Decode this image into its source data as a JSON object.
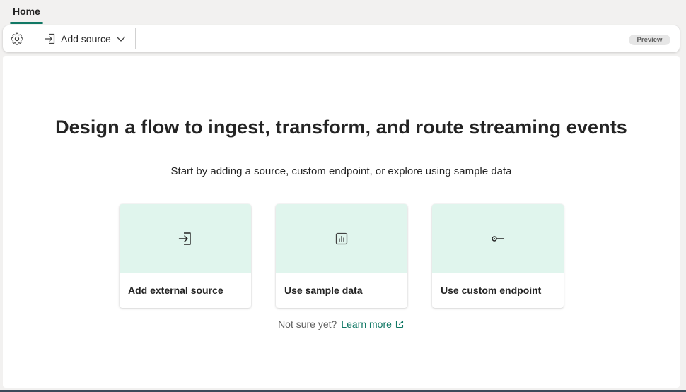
{
  "tabs": [
    {
      "label": "Home",
      "active": true
    }
  ],
  "toolbar": {
    "settings_icon": "gear-icon",
    "add_source_label": "Add source",
    "add_source_icon": "sign-in-arrow-icon",
    "preview_badge": "Preview"
  },
  "main": {
    "headline": "Design a flow to ingest, transform, and route streaming events",
    "subhead": "Start by adding a source, custom endpoint, or explore using sample data",
    "cards": [
      {
        "label": "Add external source",
        "icon": "sign-in-arrow-icon"
      },
      {
        "label": "Use sample data",
        "icon": "data-chart-icon"
      },
      {
        "label": "Use custom endpoint",
        "icon": "endpoint-plug-icon"
      }
    ],
    "not_sure_text": "Not sure yet?",
    "learn_more_label": "Learn more",
    "learn_more_icon": "open-external-icon"
  },
  "colors": {
    "accent": "#117865",
    "card_header_bg": "#e0f5ed",
    "canvas_bg": "#ffffff",
    "app_bg": "#f2f1f0"
  }
}
